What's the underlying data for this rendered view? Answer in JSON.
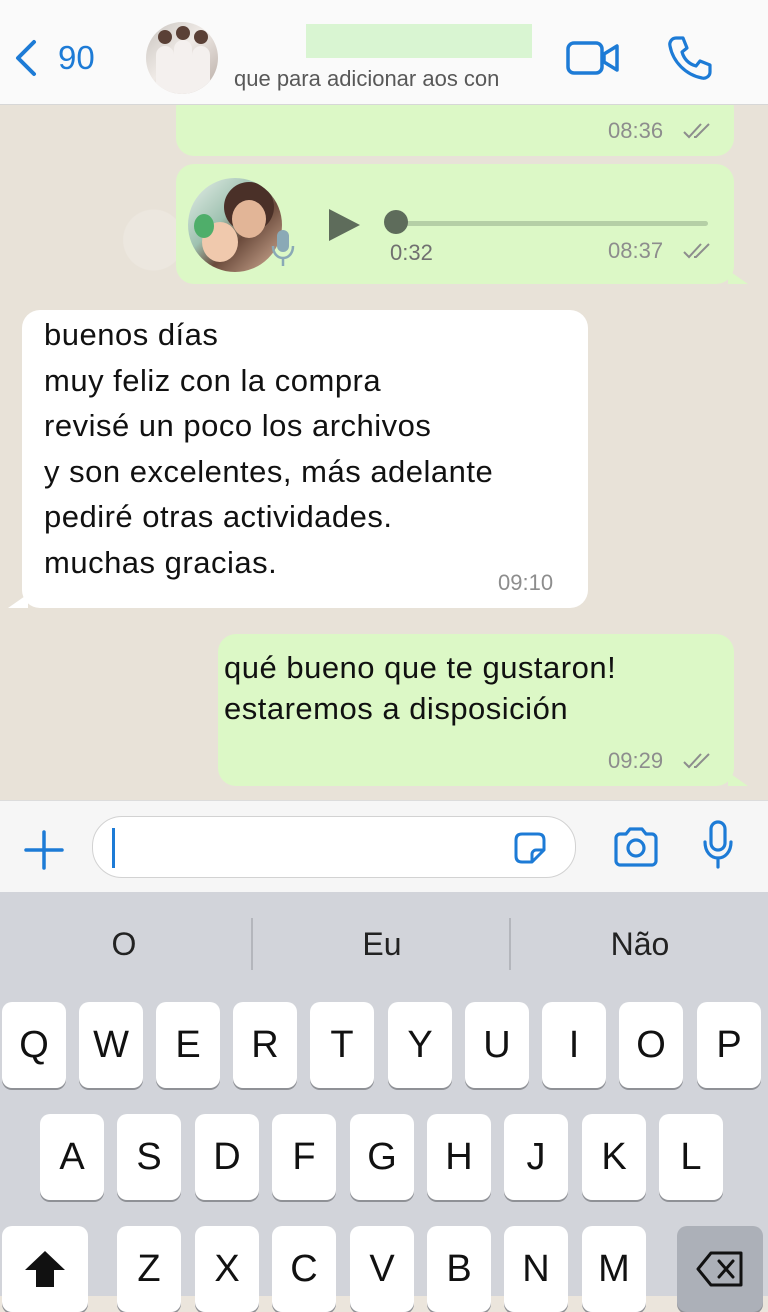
{
  "header": {
    "back_count": "90",
    "subtitle": "que para adicionar aos con"
  },
  "messages": [
    {
      "type": "outgoing",
      "time": "08:36"
    },
    {
      "type": "outgoing-audio",
      "duration": "0:32",
      "time": "08:37"
    },
    {
      "type": "incoming",
      "text": "buenos días\nmuy feliz con la compra\nrevisé un poco los archivos\ny son excelentes, más adelante\npediré otras actividades.\nmuchas gracias.",
      "time": "09:10"
    },
    {
      "type": "outgoing",
      "text": "qué bueno que te gustaron!\nestaremos a disposición",
      "time": "09:29"
    }
  ],
  "input": {
    "value": ""
  },
  "keyboard": {
    "suggestions": [
      "O",
      "Eu",
      "Não"
    ],
    "row1": [
      "Q",
      "W",
      "E",
      "R",
      "T",
      "Y",
      "U",
      "I",
      "O",
      "P"
    ],
    "row2": [
      "A",
      "S",
      "D",
      "F",
      "G",
      "H",
      "J",
      "K",
      "L"
    ],
    "row3": [
      "Z",
      "X",
      "C",
      "V",
      "B",
      "N",
      "M"
    ]
  },
  "colors": {
    "accent": "#1d7bd6",
    "outgoing_bubble": "#dcf8c6",
    "incoming_bubble": "#ffffff",
    "chat_background": "#e8e2d8",
    "keyboard_background": "#d2d4da"
  },
  "icons": [
    "back-chevron-icon",
    "video-call-icon",
    "phone-icon",
    "play-icon",
    "mic-icon",
    "double-check-icon",
    "plus-icon",
    "sticker-icon",
    "camera-icon",
    "shift-icon",
    "backspace-icon"
  ]
}
